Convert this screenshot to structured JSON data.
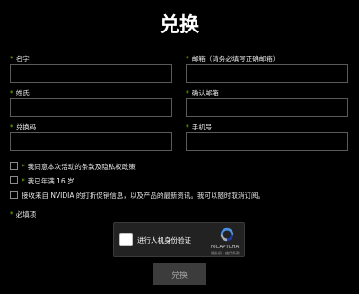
{
  "title": "兑换",
  "form": {
    "required_marker": "*",
    "fields": {
      "first_name": {
        "label": "名字",
        "value": ""
      },
      "email": {
        "label": "邮箱（请务必填写正确邮箱）",
        "value": ""
      },
      "last_name": {
        "label": "姓氏",
        "value": ""
      },
      "confirm_email": {
        "label": "确认邮箱",
        "value": ""
      },
      "code": {
        "label": "兑换码",
        "value": ""
      },
      "phone": {
        "label": "手机号",
        "value": ""
      }
    },
    "checkboxes": {
      "terms": {
        "label": "我同意本次活动的条款及隐私权政策",
        "checked": false,
        "required": true
      },
      "age": {
        "label": "我已年满 16 岁",
        "checked": false,
        "required": true
      },
      "marketing": {
        "label": "接收来自 NVIDIA 的打折促销信息，以及产品的最新资讯。我可以随时取消订阅。",
        "checked": false,
        "required": false
      }
    },
    "required_note": "必填项"
  },
  "captcha": {
    "label": "进行人机身份验证",
    "brand": "reCAPTCHA",
    "links": "隐私权 - 使用条款",
    "checked": false
  },
  "submit_label": "兑换",
  "colors": {
    "background": "#000000",
    "required_marker": "#76b900",
    "field_border": "#5a5a5a",
    "button_bg": "#3c3c3c",
    "button_text": "#a8a8a8"
  }
}
